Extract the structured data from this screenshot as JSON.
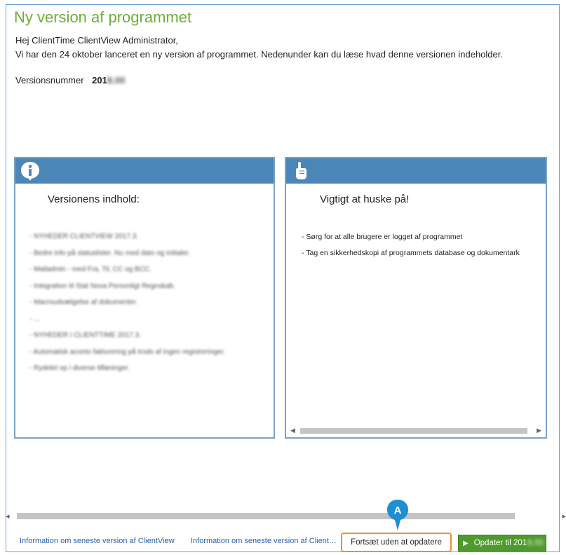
{
  "dialog": {
    "title": "Ny version af programmet",
    "greeting": "Hej ClientTime ClientView Administrator,",
    "intro": "Vi har den 24 oktober lanceret en ny version af programmet. Nedenunder kan du læse hvad denne versionen  indeholder.",
    "version_label": "Versionsnummer",
    "version_prefix": "201",
    "version_hidden": "8.00"
  },
  "left_panel": {
    "icon": "info-icon",
    "title": "Versionens indhold:",
    "items": [
      "- NYHEDER CLIENTVIEW 2017.3.",
      "- Bedre info på statuslister. Nu med dato og initialer.",
      "- Mailadmin - med Fra, Til, CC og BCC.",
      "- Integration til Stat Nova Personligt Regnskab.",
      "- Macroudvælgelse af dokumenter.",
      "- ...",
      "- NYHEDER I CLIENTTIME 2017.3.",
      "- Automatisk aconto fakturering på trods af ingen registreringer.",
      "- Rydelet op i diverse tilføninger."
    ]
  },
  "right_panel": {
    "icon": "pointing-hand-icon",
    "title": "Vigtigt at huske på!",
    "items": [
      "- Sørg for at alle brugere er logget af programmet",
      "- Tag en sikkerhedskopi af programmets database og dokumentark"
    ]
  },
  "footer": {
    "link1": "Information om seneste version af ClientView",
    "link2": "Information om seneste version af ClientTime",
    "continue_label": "Fortsæt uden at opdatere",
    "update_label": "Opdater til 201",
    "update_hidden": "8.00",
    "marker_label": "A"
  },
  "colors": {
    "title_green": "#6fae3a",
    "panel_header_blue": "#4b86b8",
    "update_green": "#4f9a2c",
    "highlight_orange": "#e8932f",
    "marker_blue": "#1f8fd3"
  }
}
